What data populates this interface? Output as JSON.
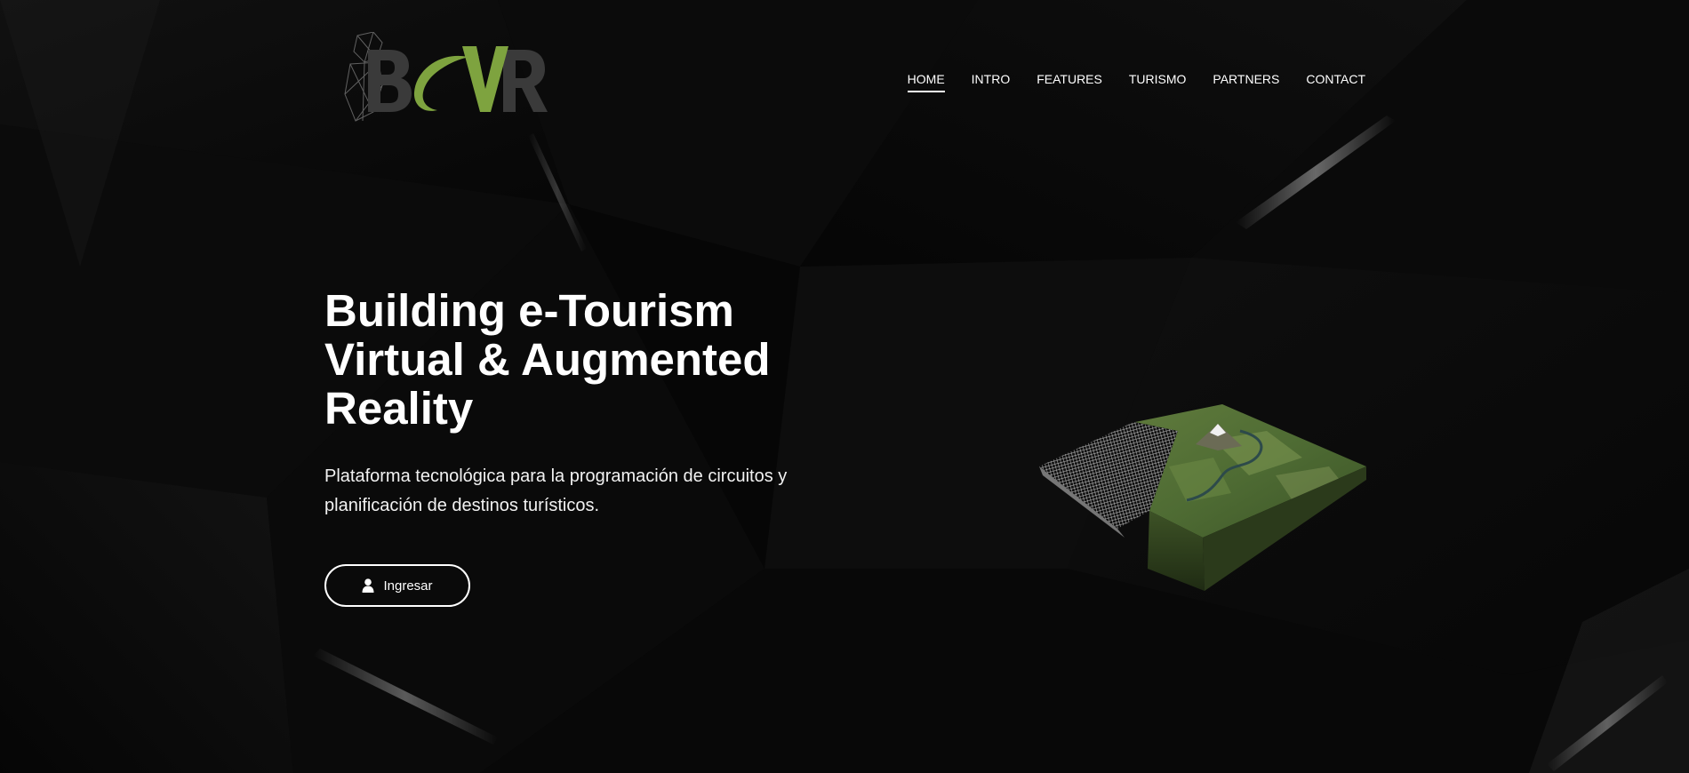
{
  "brand": {
    "logo_text": "BCNVR",
    "accent_color": "#7ea33f"
  },
  "nav": {
    "items": [
      {
        "label": "HOME",
        "active": true
      },
      {
        "label": "INTRO",
        "active": false
      },
      {
        "label": "FEATURES",
        "active": false
      },
      {
        "label": "TURISMO",
        "active": false
      },
      {
        "label": "PARTNERS",
        "active": false
      },
      {
        "label": "CONTACT",
        "active": false
      }
    ]
  },
  "hero": {
    "title_lines": [
      "Building e-Tourism",
      "Virtual & Augmented",
      "Reality"
    ],
    "subtitle": "Plataforma tecnológica para la programación de circuitos y planificación de destinos turísticos.",
    "cta_label": "Ingresar",
    "cta_icon": "user-icon",
    "illustration": "terrain-3d-map"
  },
  "colors": {
    "background": "#060606",
    "text": "#ffffff"
  }
}
